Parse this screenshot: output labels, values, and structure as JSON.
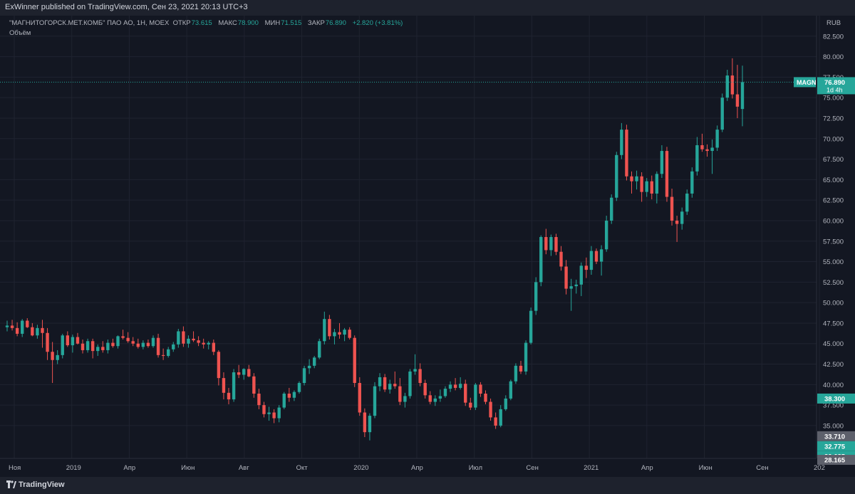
{
  "header": {
    "published_text": "ExWinner published on TradingView.com, Сен 23, 2021 20:13 UTC+3"
  },
  "legend": {
    "symbol": "\"МАГНИТОГОРСК.МЕТ.КОМБ\" ПАО АО, 1Н, МОЕХ",
    "open_label": "ОТКР",
    "open_value": "73.615",
    "high_label": "МАКС",
    "high_value": "78.900",
    "low_label": "МИН",
    "low_value": "71.515",
    "close_label": "ЗАКР",
    "close_value": "76.890",
    "change": "+2.820 (+3.81%)",
    "volume_label": "Объём",
    "currency": "RUB"
  },
  "footer": {
    "brand": "TradingView"
  },
  "colors": {
    "up": "#26a69a",
    "down": "#ef5350",
    "background": "#131722",
    "grid": "#1f2330",
    "axis_text": "#b2b5be"
  },
  "chart_data": {
    "type": "candlestick",
    "symbol": "MAGN",
    "ylim": [
      31.0,
      85.0
    ],
    "y_ticks": [
      "35.000",
      "37.500",
      "40.000",
      "42.500",
      "45.000",
      "47.500",
      "50.000",
      "52.500",
      "55.000",
      "57.500",
      "60.000",
      "62.500",
      "65.000",
      "67.500",
      "70.000",
      "72.500",
      "75.000",
      "77.500",
      "80.000",
      "82.500"
    ],
    "x_ticks": [
      "Ноя",
      "2019",
      "Апр",
      "Июн",
      "Авг",
      "Окт",
      "2020",
      "Апр",
      "Июл",
      "Сен",
      "2021",
      "Апр",
      "Июн",
      "Сен",
      "202"
    ],
    "price_labels": [
      {
        "text": "MAGN",
        "value": 76.89,
        "kind": "symbol"
      },
      {
        "text": "76.890",
        "value": 76.89,
        "kind": "last",
        "extra": "1d 4h"
      },
      {
        "text": "38.300",
        "value": 38.3,
        "kind": "up"
      },
      {
        "text": "33.710",
        "value": 33.71,
        "kind": "gray"
      },
      {
        "text": "32.775",
        "value": 32.775,
        "kind": "up"
      },
      {
        "text": "32.685",
        "value": 32.685,
        "kind": "up"
      },
      {
        "text": "32.280",
        "value": 32.28,
        "kind": "down"
      },
      {
        "text": "28.750",
        "value": 28.75,
        "kind": "gray"
      },
      {
        "text": "28.165",
        "value": 28.165,
        "kind": "gray"
      }
    ],
    "candles": [
      [
        47.0,
        47.8,
        46.5,
        47.2
      ],
      [
        47.2,
        47.9,
        46.6,
        46.9
      ],
      [
        46.9,
        47.6,
        45.9,
        46.2
      ],
      [
        46.2,
        48.0,
        45.8,
        47.8
      ],
      [
        47.8,
        48.1,
        46.9,
        47.0
      ],
      [
        47.0,
        47.5,
        45.9,
        46.0
      ],
      [
        46.0,
        47.3,
        45.6,
        46.9
      ],
      [
        46.9,
        47.9,
        44.5,
        46.3
      ],
      [
        46.3,
        46.9,
        43.0,
        44.0
      ],
      [
        44.0,
        45.2,
        40.2,
        43.0
      ],
      [
        43.0,
        44.2,
        42.5,
        43.6
      ],
      [
        43.6,
        46.2,
        43.2,
        46.0
      ],
      [
        46.0,
        46.5,
        44.6,
        44.8
      ],
      [
        44.8,
        46.1,
        43.9,
        45.8
      ],
      [
        45.8,
        46.3,
        44.9,
        45.0
      ],
      [
        45.0,
        45.5,
        43.8,
        44.2
      ],
      [
        44.2,
        45.6,
        43.9,
        45.3
      ],
      [
        45.3,
        45.6,
        43.2,
        44.1
      ],
      [
        44.1,
        44.9,
        43.5,
        44.6
      ],
      [
        44.6,
        45.3,
        43.9,
        44.2
      ],
      [
        44.2,
        45.5,
        43.8,
        45.1
      ],
      [
        45.1,
        45.6,
        44.5,
        44.7
      ],
      [
        44.7,
        46.0,
        44.4,
        45.9
      ],
      [
        45.9,
        46.7,
        45.5,
        45.7
      ],
      [
        45.7,
        46.4,
        45.1,
        45.3
      ],
      [
        45.3,
        45.8,
        44.7,
        45.0
      ],
      [
        45.0,
        45.6,
        44.4,
        44.6
      ],
      [
        44.6,
        45.4,
        44.3,
        45.1
      ],
      [
        45.1,
        45.5,
        44.5,
        44.7
      ],
      [
        44.7,
        46.0,
        44.5,
        45.7
      ],
      [
        45.7,
        46.2,
        43.3,
        43.6
      ],
      [
        43.6,
        44.4,
        43.0,
        43.5
      ],
      [
        43.5,
        44.6,
        43.3,
        44.3
      ],
      [
        44.3,
        45.2,
        44.0,
        44.9
      ],
      [
        44.9,
        46.8,
        44.5,
        46.5
      ],
      [
        46.5,
        47.1,
        44.6,
        45.0
      ],
      [
        45.0,
        46.0,
        44.5,
        45.6
      ],
      [
        45.6,
        46.5,
        45.2,
        45.4
      ],
      [
        45.4,
        45.9,
        44.7,
        45.1
      ],
      [
        45.1,
        45.6,
        44.4,
        44.9
      ],
      [
        44.9,
        45.3,
        44.3,
        45.1
      ],
      [
        45.1,
        45.5,
        43.6,
        44.0
      ],
      [
        44.0,
        44.2,
        39.9,
        40.8
      ],
      [
        40.8,
        41.5,
        38.2,
        39.0
      ],
      [
        39.0,
        39.6,
        37.6,
        38.2
      ],
      [
        38.2,
        41.9,
        37.9,
        41.5
      ],
      [
        41.5,
        42.4,
        40.8,
        41.2
      ],
      [
        41.2,
        42.0,
        40.6,
        41.9
      ],
      [
        41.9,
        42.4,
        40.9,
        41.0
      ],
      [
        41.0,
        41.4,
        38.4,
        38.9
      ],
      [
        38.9,
        39.5,
        37.0,
        37.5
      ],
      [
        37.5,
        37.9,
        36.0,
        36.4
      ],
      [
        36.4,
        37.3,
        35.6,
        36.6
      ],
      [
        36.6,
        37.0,
        35.3,
        35.9
      ],
      [
        35.9,
        37.5,
        35.4,
        37.2
      ],
      [
        37.2,
        39.1,
        37.0,
        38.9
      ],
      [
        38.9,
        39.6,
        37.9,
        38.4
      ],
      [
        38.4,
        39.3,
        38.0,
        39.1
      ],
      [
        39.1,
        40.4,
        38.9,
        40.2
      ],
      [
        40.2,
        42.3,
        39.9,
        42.0
      ],
      [
        42.0,
        43.1,
        41.3,
        42.3
      ],
      [
        42.3,
        43.5,
        42.0,
        43.3
      ],
      [
        43.3,
        45.6,
        43.1,
        45.3
      ],
      [
        45.3,
        48.9,
        44.9,
        48.0
      ],
      [
        48.0,
        48.5,
        45.5,
        45.9
      ],
      [
        45.9,
        46.8,
        44.9,
        46.4
      ],
      [
        46.4,
        47.5,
        45.6,
        46.1
      ],
      [
        46.1,
        46.9,
        45.3,
        46.7
      ],
      [
        46.7,
        47.0,
        45.5,
        45.7
      ],
      [
        45.7,
        46.0,
        39.7,
        40.2
      ],
      [
        40.2,
        40.9,
        36.2,
        36.6
      ],
      [
        36.6,
        37.1,
        33.6,
        34.2
      ],
      [
        34.2,
        36.5,
        33.2,
        36.2
      ],
      [
        36.2,
        40.3,
        35.9,
        39.8
      ],
      [
        39.8,
        41.4,
        39.2,
        40.9
      ],
      [
        40.9,
        41.3,
        39.1,
        39.4
      ],
      [
        39.4,
        40.6,
        38.9,
        40.1
      ],
      [
        40.1,
        41.6,
        39.5,
        39.8
      ],
      [
        39.8,
        40.8,
        37.5,
        37.9
      ],
      [
        37.9,
        39.0,
        37.2,
        38.6
      ],
      [
        38.6,
        41.9,
        38.3,
        41.6
      ],
      [
        41.6,
        43.7,
        41.2,
        41.9
      ],
      [
        41.9,
        42.6,
        39.8,
        40.2
      ],
      [
        40.2,
        40.6,
        38.3,
        38.7
      ],
      [
        38.7,
        39.2,
        37.6,
        37.9
      ],
      [
        37.9,
        38.7,
        37.4,
        38.3
      ],
      [
        38.3,
        39.4,
        37.9,
        38.6
      ],
      [
        38.6,
        39.8,
        38.4,
        39.5
      ],
      [
        39.5,
        40.4,
        39.1,
        40.0
      ],
      [
        40.0,
        40.8,
        39.3,
        39.6
      ],
      [
        39.6,
        40.9,
        39.4,
        40.1
      ],
      [
        40.1,
        40.6,
        37.4,
        37.8
      ],
      [
        37.8,
        38.4,
        36.9,
        37.2
      ],
      [
        37.2,
        40.2,
        36.9,
        40.0
      ],
      [
        40.0,
        40.3,
        38.5,
        38.9
      ],
      [
        38.9,
        39.3,
        37.6,
        37.9
      ],
      [
        37.9,
        38.3,
        35.6,
        36.0
      ],
      [
        36.0,
        36.6,
        34.6,
        35.0
      ],
      [
        35.0,
        37.5,
        34.8,
        37.0
      ],
      [
        37.0,
        38.7,
        36.8,
        38.3
      ],
      [
        38.3,
        40.6,
        38.1,
        40.4
      ],
      [
        40.4,
        42.6,
        40.1,
        42.3
      ],
      [
        42.3,
        42.9,
        41.3,
        41.6
      ],
      [
        41.6,
        45.4,
        41.2,
        45.1
      ],
      [
        45.1,
        49.4,
        44.9,
        49.0
      ],
      [
        49.0,
        53.1,
        48.5,
        52.5
      ],
      [
        52.5,
        58.2,
        52.0,
        58.0
      ],
      [
        58.0,
        59.0,
        55.9,
        56.4
      ],
      [
        56.4,
        58.3,
        55.7,
        58.0
      ],
      [
        58.0,
        58.4,
        55.8,
        56.2
      ],
      [
        56.2,
        56.9,
        53.9,
        54.4
      ],
      [
        54.4,
        55.2,
        51.0,
        51.7
      ],
      [
        51.7,
        52.9,
        49.0,
        52.0
      ],
      [
        52.0,
        52.8,
        51.1,
        52.2
      ],
      [
        52.2,
        54.9,
        50.8,
        54.5
      ],
      [
        54.5,
        55.5,
        53.0,
        54.0
      ],
      [
        54.0,
        56.9,
        53.4,
        56.3
      ],
      [
        56.3,
        56.6,
        54.7,
        55.0
      ],
      [
        55.0,
        57.0,
        53.3,
        56.5
      ],
      [
        56.5,
        60.6,
        56.2,
        60.0
      ],
      [
        60.0,
        63.2,
        59.6,
        62.8
      ],
      [
        62.8,
        68.4,
        62.4,
        68.0
      ],
      [
        68.0,
        71.9,
        67.5,
        71.1
      ],
      [
        71.1,
        71.7,
        64.9,
        65.4
      ],
      [
        65.4,
        66.0,
        63.3,
        64.8
      ],
      [
        64.8,
        66.1,
        63.8,
        65.4
      ],
      [
        65.4,
        65.9,
        62.3,
        63.5
      ],
      [
        63.5,
        65.2,
        62.9,
        64.8
      ],
      [
        64.8,
        65.5,
        62.6,
        63.3
      ],
      [
        63.3,
        66.0,
        62.1,
        65.7
      ],
      [
        65.7,
        69.2,
        65.2,
        68.5
      ],
      [
        68.5,
        69.0,
        62.3,
        62.9
      ],
      [
        62.9,
        63.9,
        59.4,
        60.0
      ],
      [
        60.0,
        60.6,
        57.4,
        59.6
      ],
      [
        59.6,
        61.6,
        58.9,
        61.1
      ],
      [
        61.1,
        63.8,
        60.7,
        63.3
      ],
      [
        63.3,
        66.5,
        62.8,
        66.0
      ],
      [
        66.0,
        70.2,
        65.5,
        69.2
      ],
      [
        69.2,
        70.6,
        68.4,
        68.7
      ],
      [
        68.7,
        69.3,
        67.8,
        68.5
      ],
      [
        68.5,
        69.9,
        65.7,
        68.9
      ],
      [
        68.9,
        71.6,
        68.5,
        71.1
      ],
      [
        71.1,
        75.5,
        70.8,
        75.0
      ],
      [
        75.0,
        78.4,
        74.6,
        77.7
      ],
      [
        77.7,
        79.8,
        74.9,
        75.4
      ],
      [
        75.4,
        79.0,
        72.5,
        73.9
      ],
      [
        73.615,
        78.9,
        71.515,
        76.89
      ]
    ]
  }
}
